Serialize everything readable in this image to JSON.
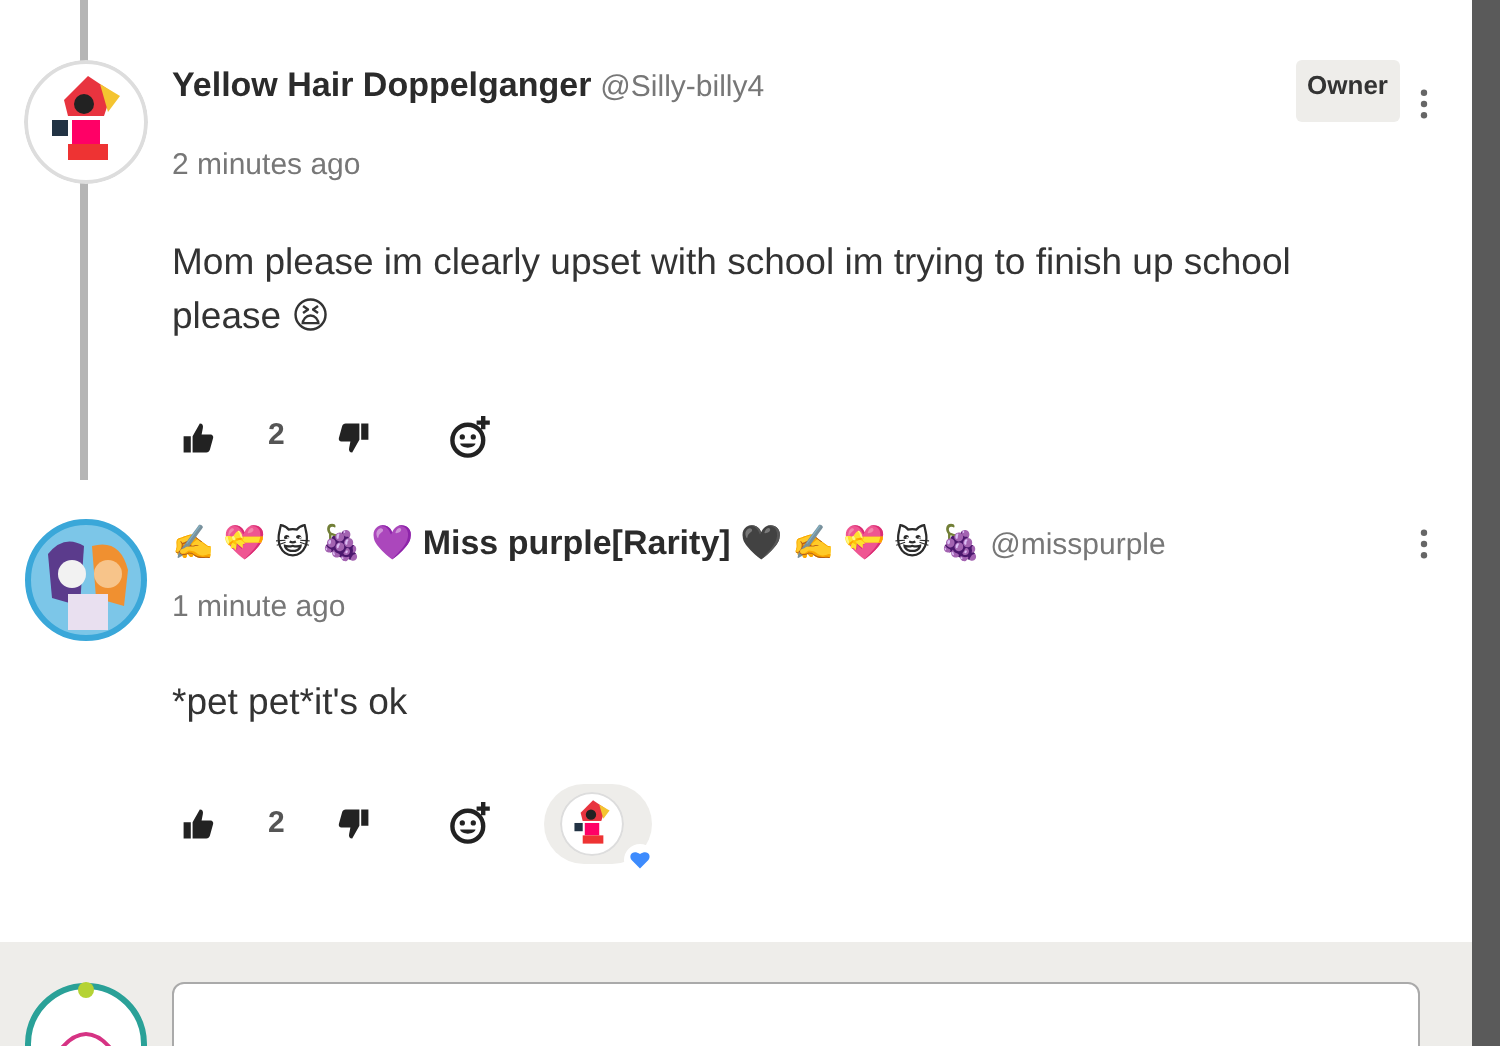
{
  "comments": [
    {
      "author": "Yellow Hair Doppelganger",
      "handle": "@Silly-billy4",
      "badge": "Owner",
      "time": "2 minutes ago",
      "body": "Mom please im clearly upset with school im trying to finish up school please 😫",
      "likes": "2"
    },
    {
      "author": "✍️ 💝 😺 🍇 💜 Miss purple[Rarity] 🖤 ✍️ 💝 😺 🍇",
      "handle": "@misspurple",
      "time": "1 minute ago",
      "body": "*pet pet*it's ok",
      "likes": "2",
      "reactions": [
        {
          "kind": "heart"
        }
      ]
    }
  ]
}
